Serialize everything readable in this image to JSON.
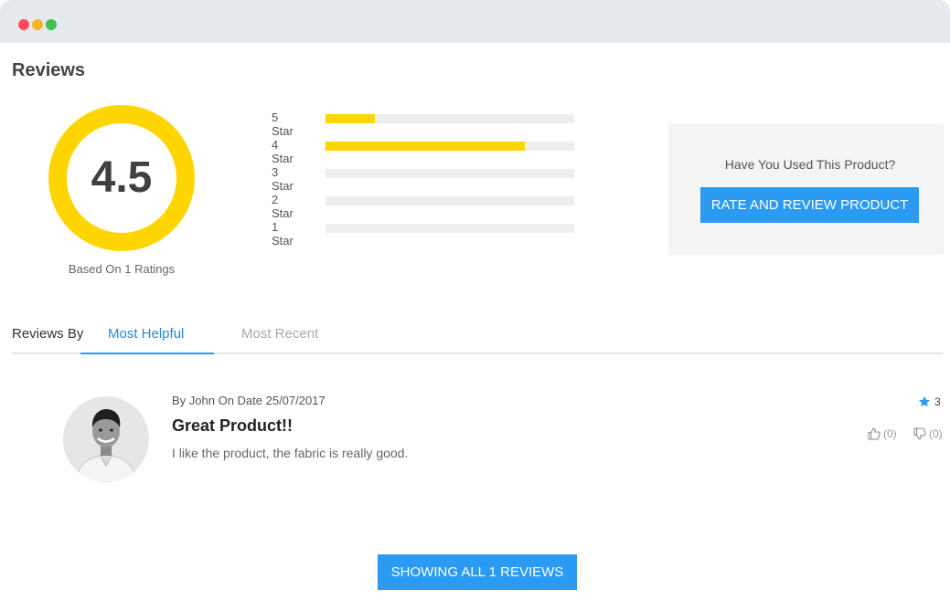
{
  "window": {
    "controls": [
      "close",
      "minimize",
      "maximize"
    ]
  },
  "reviews": {
    "title": "Reviews",
    "average_rating": "4.5",
    "based_on": "Based On 1 Ratings",
    "distribution": [
      {
        "label": "5 Star",
        "fraction": 0.2
      },
      {
        "label": "4 Star",
        "fraction": 0.8
      },
      {
        "label": "3 Star",
        "fraction": 0
      },
      {
        "label": "2 Star",
        "fraction": 0
      },
      {
        "label": "1 Star",
        "fraction": 0
      }
    ],
    "accent_color": "#ffd500"
  },
  "cta": {
    "question": "Have You Used This Product?",
    "button_label": "RATE AND REVIEW PRODUCT"
  },
  "sort": {
    "label": "Reviews By",
    "tabs": [
      {
        "label": "Most Helpful",
        "active": true
      },
      {
        "label": "Most Recent",
        "active": false
      }
    ]
  },
  "review_list": [
    {
      "meta": "By John On Date 25/07/2017",
      "title": "Great Product!!",
      "body": "I like the product, the fabric is really good.",
      "star_count": "3",
      "upvotes": "(0)",
      "downvotes": "(0)"
    }
  ],
  "footer": {
    "show_all_label": "SHOWING ALL 1 REVIEWS"
  },
  "colors": {
    "primary": "#2b9af3",
    "tab_active": "#2b86d4"
  }
}
